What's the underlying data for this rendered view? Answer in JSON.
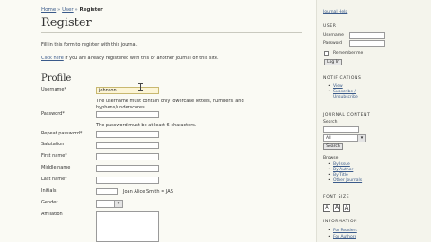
{
  "breadcrumb": {
    "home": "Home",
    "sep1": " » ",
    "user": "User",
    "sep2": " » ",
    "current": "Register"
  },
  "page_title": "Register",
  "intro": {
    "line1": "Fill in this form to register with this journal.",
    "click_here": "Click here",
    "line2_rest": " if you are already registered with this or another journal on this site."
  },
  "section_title": "Profile",
  "form": {
    "username_label": "Username*",
    "username_value": "johnson",
    "username_help1": "The username must contain only lowercase letters, numbers, and",
    "username_help2": "hyphens/underscores.",
    "password_label": "Password*",
    "password_help": "The password must be at least 6 characters.",
    "repeat_password_label": "Repeat password*",
    "salutation_label": "Salutation",
    "first_name_label": "First name*",
    "middle_name_label": "Middle name",
    "last_name_label": "Last name*",
    "initials_label": "Initials",
    "initials_example": "Joan Alice Smith = JAS",
    "gender_label": "Gender",
    "affiliation_label": "Affiliation"
  },
  "sidebar": {
    "journal_help": "Journal Help",
    "user_heading": "USER",
    "username_label": "Username",
    "password_label": "Password",
    "remember_me": "Remember me",
    "login_button": "Log In",
    "notifications_heading": "NOTIFICATIONS",
    "notif_view": "View",
    "notif_subscribe": "Subscribe / Unsubscribe",
    "journal_content_heading": "JOURNAL CONTENT",
    "search_label": "Search",
    "search_scope": "All",
    "search_button": "Search",
    "browse_label": "Browse",
    "browse_issue": "By Issue",
    "browse_author": "By Author",
    "browse_title": "By Title",
    "browse_other": "Other Journals",
    "font_size_heading": "FONT SIZE",
    "information_heading": "INFORMATION",
    "info_readers": "For Readers",
    "info_authors": "For Authors"
  }
}
